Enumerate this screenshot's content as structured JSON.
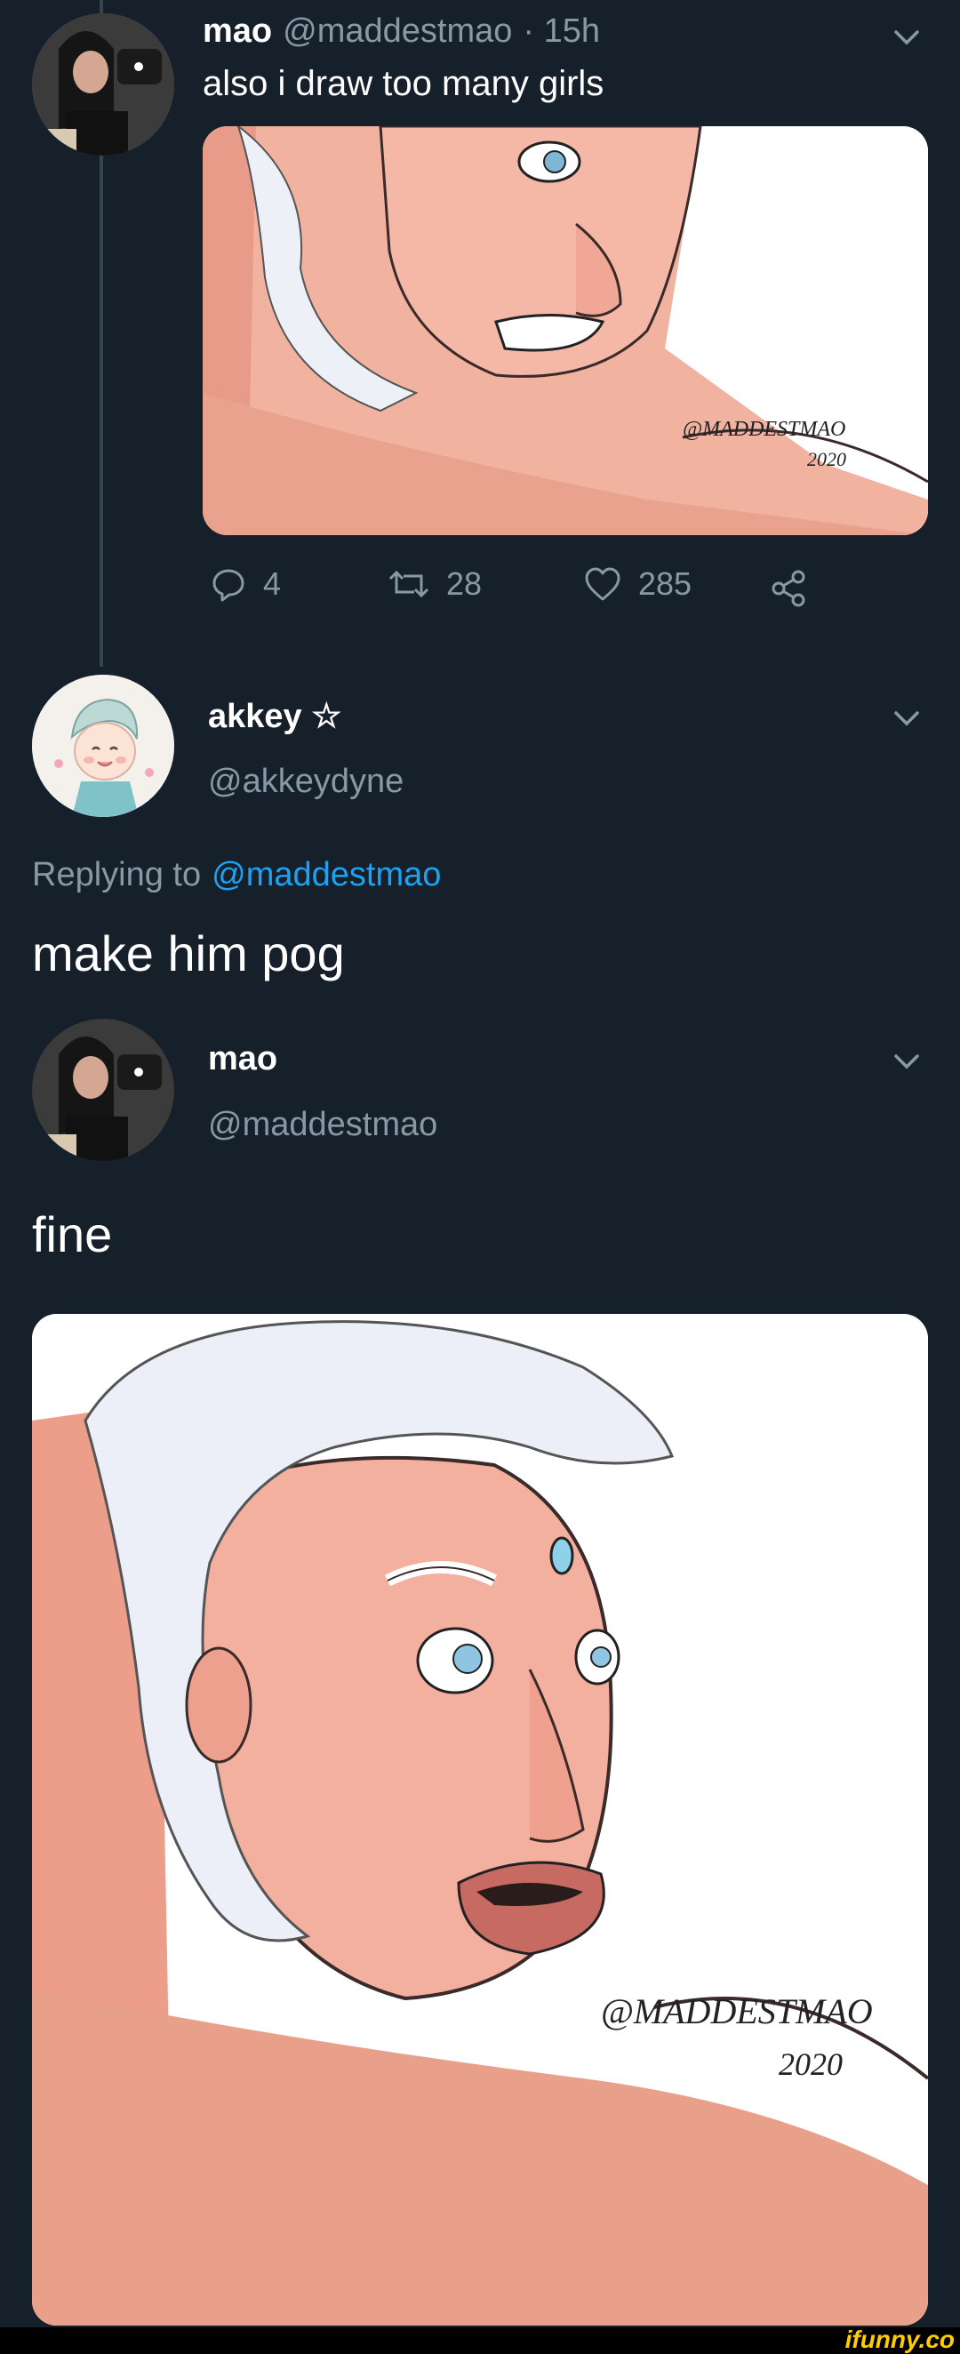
{
  "tweet1": {
    "display_name": "mao",
    "handle": "@maddestmao",
    "time": "· 15h",
    "text": "also i draw too many girls",
    "image_signature_line1": "@MADDESTMAO",
    "image_signature_line2": "2020",
    "stats": {
      "replies": "4",
      "retweets": "28",
      "likes": "285"
    }
  },
  "reply1": {
    "display_name": "akkey ☆",
    "handle": "@akkeydyne",
    "replying_prefix": "Replying to",
    "replying_handle": "@maddestmao",
    "text": "make him pog"
  },
  "reply2": {
    "display_name": "mao",
    "handle": "@maddestmao",
    "text": "fine",
    "image_signature_line1": "@MADDESTMAO",
    "image_signature_line2": "2020"
  },
  "watermark": "ifunny.co",
  "colors": {
    "background": "#15202b",
    "link": "#1da1f2",
    "muted": "#8899a6"
  }
}
